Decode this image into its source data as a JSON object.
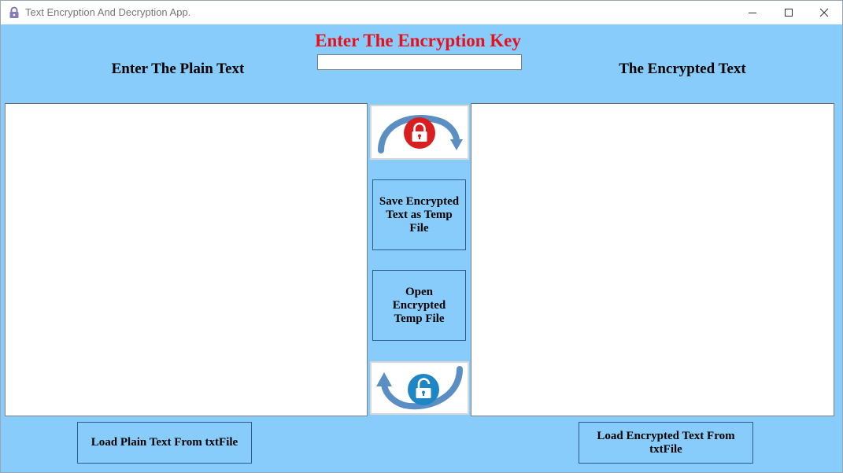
{
  "window": {
    "title": "Text Encryption And Decryption App.",
    "controls": {
      "minimize": "minimize-icon",
      "maximize": "maximize-icon",
      "close": "close-icon"
    }
  },
  "key_section": {
    "title": "Enter The Encryption Key",
    "input_value": ""
  },
  "plain_panel": {
    "heading": "Enter The Plain Text",
    "text": "",
    "load_button": "Load Plain Text From txtFile"
  },
  "encrypted_panel": {
    "heading": "The Encrypted Text",
    "text": "",
    "load_button": "Load Encrypted Text From txtFile"
  },
  "middle": {
    "encrypt_icon": "lock-closed-icon",
    "decrypt_icon": "lock-open-icon",
    "save_button": "Save Encrypted Text as Temp File",
    "open_button": "Open Encrypted Temp File"
  },
  "colors": {
    "background": "#87ccfa",
    "key_title": "#e8101d",
    "lock_red": "#d81e1e",
    "lock_blue": "#1e86c4",
    "arrow_blue": "#5b8fc4"
  }
}
